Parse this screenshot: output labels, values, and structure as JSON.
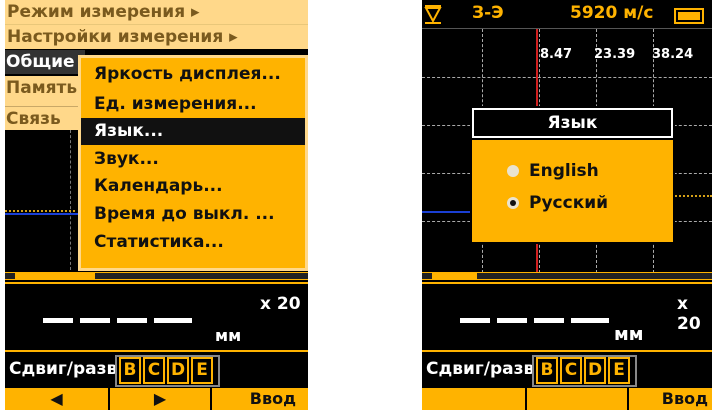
{
  "left_screen": {
    "main_menu": {
      "items": [
        {
          "label": "Режим измерения ▸"
        },
        {
          "label": "Настройки измерения ▸"
        }
      ]
    },
    "side_menu": {
      "items": [
        {
          "label": "Общие",
          "active": true
        },
        {
          "label": "Память",
          "active": false
        },
        {
          "label": "Связь",
          "active": false
        }
      ]
    },
    "submenu": {
      "items": [
        {
          "label": "Яркость дисплея...",
          "selected": false
        },
        {
          "label": "Ед. измерения...",
          "selected": false
        },
        {
          "label": "Язык...",
          "selected": true
        },
        {
          "label": "Звук...",
          "selected": false
        },
        {
          "label": "Календарь...",
          "selected": false
        },
        {
          "label": "Время до выкл. ...",
          "selected": false
        },
        {
          "label": "Статистика...",
          "selected": false
        }
      ]
    },
    "readout": {
      "zoom": "x 20",
      "value": "-----",
      "unit": "мм"
    },
    "gates": {
      "label": "Сдвиг/разв.",
      "items": [
        {
          "label": "B",
          "filled": false
        },
        {
          "label": "C",
          "filled": false
        },
        {
          "label": "D",
          "filled": false
        },
        {
          "label": "E",
          "filled": false
        }
      ]
    },
    "softkeys": [
      {
        "label": "◀"
      },
      {
        "label": "▶"
      },
      {
        "label": "Ввод"
      }
    ]
  },
  "right_screen": {
    "status": {
      "gate_icon": "gate-triangle-icon",
      "mode": "З-Э",
      "velocity": "5920 м/с",
      "battery_icon": "battery-icon"
    },
    "measurements": [
      "8.47",
      "23.39",
      "38.24"
    ],
    "dialog": {
      "title": "Язык",
      "options": [
        {
          "label": "English",
          "checked": false
        },
        {
          "label": "Русский",
          "checked": true
        }
      ]
    },
    "readout": {
      "zoom": "x 20",
      "value": "-----",
      "unit": "мм"
    },
    "gates": {
      "label": "Сдвиг/разв.",
      "items": [
        {
          "label": "B",
          "filled": false
        },
        {
          "label": "C",
          "filled": false
        },
        {
          "label": "D",
          "filled": false
        },
        {
          "label": "E",
          "filled": false
        }
      ]
    },
    "softkeys": [
      {
        "label": ""
      },
      {
        "label": ""
      },
      {
        "label": "Ввод"
      }
    ]
  },
  "colors": {
    "accent": "#ffb300",
    "menu_bg": "#ffd88a",
    "menu_text": "#7a5a1e",
    "trace_blue": "#1a3fd4",
    "marker_red": "#d12020"
  }
}
